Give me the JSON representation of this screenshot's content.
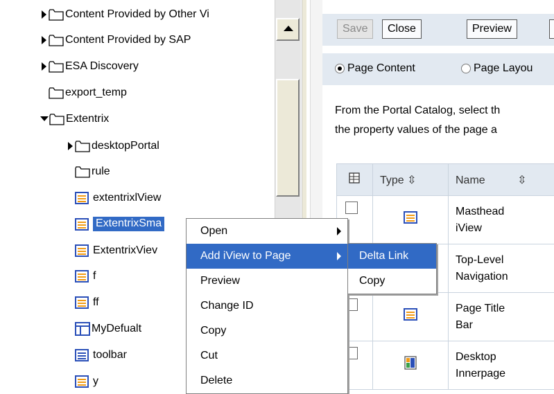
{
  "tree": {
    "items": [
      {
        "label": "Content Provided by Other Vi",
        "type": "folder",
        "expander": "right"
      },
      {
        "label": "Content Provided by SAP",
        "type": "folder",
        "expander": "right"
      },
      {
        "label": "ESA Discovery",
        "type": "folder",
        "expander": "right"
      },
      {
        "label": "export_temp",
        "type": "folder",
        "expander": ""
      },
      {
        "label": "Extentrix",
        "type": "folder",
        "expander": "down"
      },
      {
        "label": "desktopPortal",
        "type": "folder",
        "expander": "right"
      },
      {
        "label": "rule",
        "type": "folder",
        "expander": ""
      },
      {
        "label": "extentrixlView",
        "type": "iview",
        "expander": ""
      },
      {
        "label": "ExtentrixSma",
        "type": "iview",
        "expander": "",
        "selected": true
      },
      {
        "label": "ExtentrixViev",
        "type": "iview",
        "expander": ""
      },
      {
        "label": "f",
        "type": "iview",
        "expander": ""
      },
      {
        "label": "ff",
        "type": "iview",
        "expander": ""
      },
      {
        "label": "MyDefualt",
        "type": "layout",
        "expander": ""
      },
      {
        "label": "toolbar",
        "type": "iview",
        "expander": ""
      },
      {
        "label": "y",
        "type": "iview",
        "expander": ""
      }
    ]
  },
  "toolbar": {
    "save": "Save",
    "close": "Close",
    "preview": "Preview"
  },
  "radios": {
    "page_content": "Page Content",
    "page_layout": "Page Layou"
  },
  "description": {
    "line1": "From the Portal Catalog, select th",
    "line2": "the property values of the page a"
  },
  "table": {
    "type_header": "Type ⇳",
    "name_header": "Name",
    "rows": [
      {
        "name1": "Masthead",
        "name2": "iView",
        "icon": "iview"
      },
      {
        "name1": "Top-Level",
        "name2": "Navigation",
        "icon": "iview"
      },
      {
        "name1": "Page Title",
        "name2": "Bar",
        "icon": "iview"
      },
      {
        "name1": "Desktop",
        "name2": "Innerpage",
        "icon": "page"
      }
    ]
  },
  "context_menu": {
    "items": [
      {
        "label": "Open",
        "submenu": true
      },
      {
        "label": "Add iView to Page",
        "submenu": true,
        "highlighted": true
      },
      {
        "label": "Preview"
      },
      {
        "label": "Change ID"
      },
      {
        "label": "Copy"
      },
      {
        "label": "Cut"
      },
      {
        "label": "Delete"
      }
    ]
  },
  "submenu": {
    "items": [
      {
        "label": "Delta Link",
        "highlighted": true
      },
      {
        "label": "Copy"
      }
    ]
  },
  "colors": {
    "selection": "#316ac5",
    "toolbar_bg": "#e2e9f1",
    "iview_icon": "#2a4fb8",
    "iview_icon_bar": "#f29b14"
  }
}
